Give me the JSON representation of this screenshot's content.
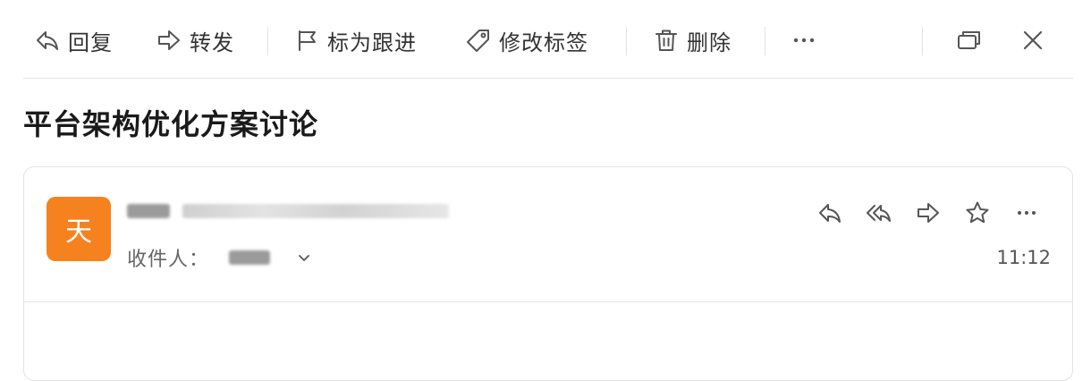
{
  "toolbar": {
    "reply_label": "回复",
    "forward_label": "转发",
    "flag_label": "标为跟进",
    "tag_label": "修改标签",
    "delete_label": "删除"
  },
  "email": {
    "subject": "平台架构优化方案讨论",
    "avatar_letter": "天",
    "recipient_label": "收件人：",
    "time": "11:12"
  },
  "colors": {
    "avatar_bg": "#f5821f",
    "icon": "#555555",
    "divider": "#e6e6e6"
  }
}
